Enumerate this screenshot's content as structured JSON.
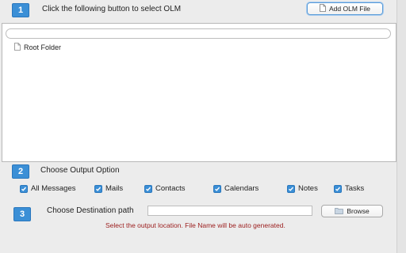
{
  "step1": {
    "number": "1",
    "label": "Click the following button to select OLM",
    "add_button_label": "Add OLM File"
  },
  "panel": {
    "search_value": "",
    "tree": [
      {
        "label": "Root Folder",
        "icon": "file-icon"
      }
    ]
  },
  "step2": {
    "number": "2",
    "label": "Choose Output Option",
    "options": [
      {
        "label": "All Messages",
        "checked": true
      },
      {
        "label": "Mails",
        "checked": true
      },
      {
        "label": "Contacts",
        "checked": true
      },
      {
        "label": "Calendars",
        "checked": true
      },
      {
        "label": "Notes",
        "checked": true
      },
      {
        "label": "Tasks",
        "checked": true
      }
    ]
  },
  "step3": {
    "number": "3",
    "label": "Choose Destination path",
    "path_value": "",
    "browse_label": "Browse",
    "hint": "Select the output location. File Name will be auto generated."
  },
  "colors": {
    "accent": "#3b8fd6",
    "hint": "#9b1c1c",
    "background": "#ececec"
  }
}
